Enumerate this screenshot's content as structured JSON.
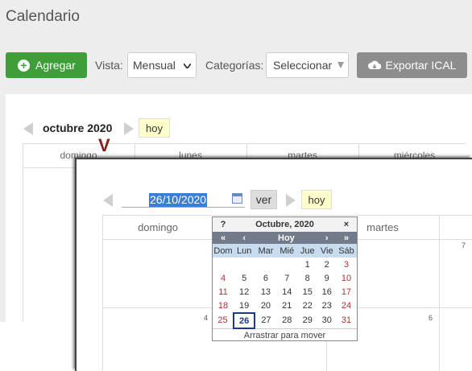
{
  "header": {
    "title": "Calendario",
    "add_label": "Agregar",
    "view_label": "Vista:",
    "view_value": "Mensual",
    "categories_label": "Categorías:",
    "categories_value": "Seleccionar",
    "export_label": "Exportar ICAL"
  },
  "calendar": {
    "month_label": "octubre 2020",
    "today_label": "hoy",
    "weekdays": [
      "domingo",
      "lunes",
      "martes",
      "miércoles"
    ]
  },
  "zoom": {
    "date_value": "26/10/2020",
    "go_label": "ver",
    "today_label": "hoy",
    "weekdays": [
      "domingo",
      "martes"
    ],
    "day_numbers": [
      "4",
      "6",
      "7"
    ]
  },
  "picker": {
    "help": "?",
    "title": "Octubre, 2020",
    "close": "×",
    "nav_prev_year": "«",
    "nav_prev_month": "‹",
    "nav_today": "Hoy",
    "nav_next_month": "›",
    "nav_next_year": "»",
    "day_names": [
      "Dom",
      "Lun",
      "Mar",
      "Mié",
      "Jue",
      "Vie",
      "Sáb"
    ],
    "weeks": [
      [
        "",
        "",
        "",
        "",
        "1",
        "2",
        "3"
      ],
      [
        "4",
        "5",
        "6",
        "7",
        "8",
        "9",
        "10"
      ],
      [
        "11",
        "12",
        "13",
        "14",
        "15",
        "16",
        "17"
      ],
      [
        "18",
        "19",
        "20",
        "21",
        "22",
        "23",
        "24"
      ],
      [
        "25",
        "26",
        "27",
        "28",
        "29",
        "30",
        "31"
      ]
    ],
    "selected_day": "26",
    "footer": "Arrastrar para mover"
  }
}
